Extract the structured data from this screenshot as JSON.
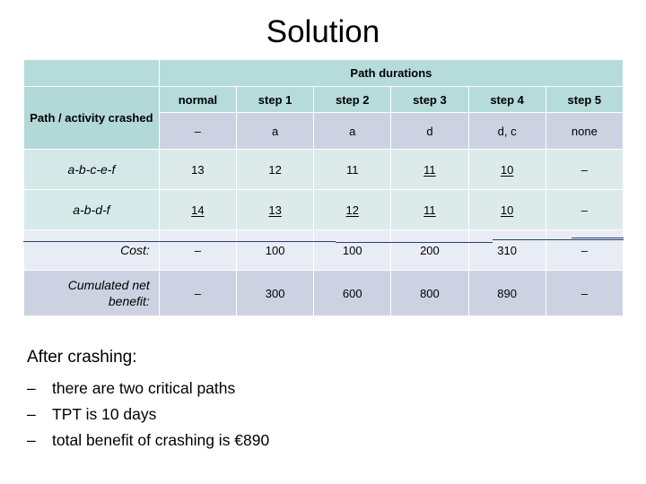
{
  "slide": {
    "title": "Solution"
  },
  "table": {
    "group_header": {
      "blank_label": "",
      "title": "Path durations"
    },
    "row_head_label": "Path / activity crashed",
    "step_columns": [
      "normal",
      "step 1",
      "step 2",
      "step 3",
      "step 4",
      "step 5"
    ],
    "crashed_row": {
      "values": [
        "–",
        "a",
        "a",
        "d",
        "d, c",
        "none"
      ]
    },
    "path_rows": [
      {
        "name": "a-b-c-e-f",
        "cells": [
          {
            "value": "13",
            "underline": false
          },
          {
            "value": "12",
            "underline": false
          },
          {
            "value": "11",
            "underline": false
          },
          {
            "value": "11",
            "underline": true
          },
          {
            "value": "10",
            "underline": true
          },
          {
            "value": "–",
            "underline": false
          }
        ]
      },
      {
        "name": "a-b-d-f",
        "cells": [
          {
            "value": "14",
            "underline": true
          },
          {
            "value": "13",
            "underline": true
          },
          {
            "value": "12",
            "underline": true
          },
          {
            "value": "11",
            "underline": true
          },
          {
            "value": "10",
            "underline": true
          },
          {
            "value": "–",
            "underline": false
          }
        ]
      }
    ],
    "cost_row": {
      "label": "Cost:",
      "values": [
        "–",
        "100",
        "100",
        "200",
        "310",
        "–"
      ]
    },
    "benefit_row": {
      "label": "Cumulated net benefit:",
      "values": [
        "–",
        "300",
        "600",
        "800",
        "890",
        "–"
      ]
    }
  },
  "summary": {
    "heading": "After crashing:",
    "bullet_marker": "–",
    "bullets": [
      "there are two critical paths",
      "TPT is 10 days",
      "total benefit of crashing is €890"
    ]
  },
  "colors": {
    "header_teal": "#b6dbdb",
    "rowhead_teal": "#b2d8d8",
    "header_text": "#2d7d8a",
    "path_row_bg": "#dceaea",
    "crashed_bg": "#ccd2e2",
    "cost_bg": "#e8ecf4",
    "benefit_bg": "#ccd2e2",
    "separator_navy": "#2e3f6b"
  }
}
